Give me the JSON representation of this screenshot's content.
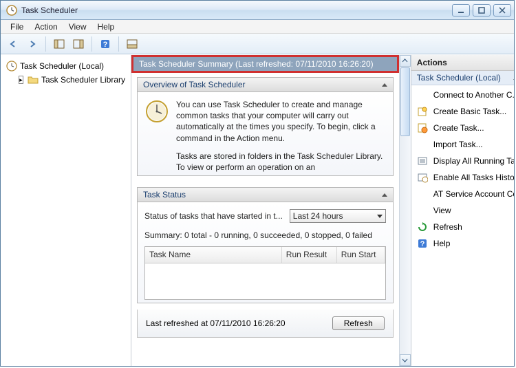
{
  "window": {
    "title": "Task Scheduler"
  },
  "menu": {
    "file": "File",
    "action": "Action",
    "view": "View",
    "help": "Help"
  },
  "tree": {
    "root": "Task Scheduler (Local)",
    "library": "Task Scheduler Library"
  },
  "summary_bar": "Task Scheduler Summary (Last refreshed: 07/11/2010 16:26:20)",
  "overview": {
    "title": "Overview of Task Scheduler",
    "para1": "You can use Task Scheduler to create and manage common tasks that your computer will carry out automatically at the times you specify. To begin, click a command in the Action menu.",
    "para2": "Tasks are stored in folders in the Task Scheduler Library. To view or perform an operation on an"
  },
  "status": {
    "title": "Task Status",
    "label": "Status of tasks that have started in t...",
    "dropdown_value": "Last 24 hours",
    "summary_line": "Summary: 0 total - 0 running, 0 succeeded, 0 stopped, 0 failed",
    "col1": "Task Name",
    "col2": "Run Result",
    "col3": "Run Start"
  },
  "footer": {
    "text": "Last refreshed at 07/11/2010 16:26:20",
    "refresh": "Refresh"
  },
  "actions": {
    "header": "Actions",
    "section": "Task Scheduler (Local)",
    "items": {
      "connect": "Connect to Another C...",
      "create_basic": "Create Basic Task...",
      "create_task": "Create Task...",
      "import_task": "Import Task...",
      "display_running": "Display All Running Ta...",
      "enable_history": "Enable All Tasks History",
      "at_service": "AT Service Account Co...",
      "view": "View",
      "refresh": "Refresh",
      "help": "Help"
    }
  }
}
